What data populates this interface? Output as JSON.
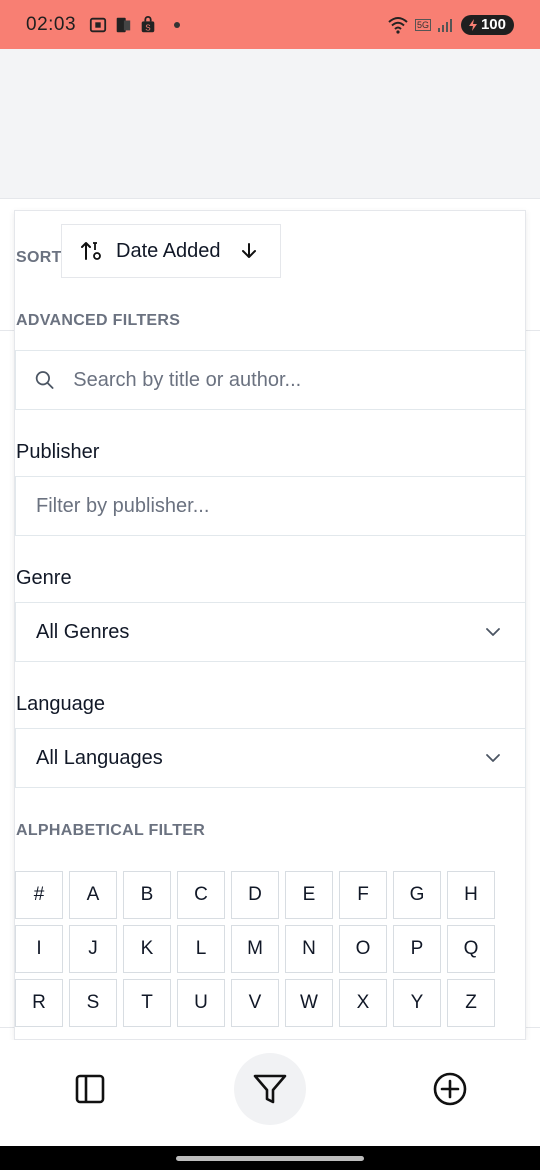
{
  "status": {
    "time": "02:03",
    "battery": "100",
    "net": "5G"
  },
  "sort": {
    "label": "SORT",
    "value": "Date Added"
  },
  "filters": {
    "advanced_label": "ADVANCED FILTERS",
    "search_placeholder": "Search by title or author...",
    "publisher_label": "Publisher",
    "publisher_placeholder": "Filter by publisher...",
    "genre_label": "Genre",
    "genre_value": "All Genres",
    "language_label": "Language",
    "language_value": "All Languages",
    "alpha_label": "ALPHABETICAL FILTER",
    "letters": [
      "#",
      "A",
      "B",
      "C",
      "D",
      "E",
      "F",
      "G",
      "H",
      "I",
      "J",
      "K",
      "L",
      "M",
      "N",
      "O",
      "P",
      "Q",
      "R",
      "S",
      "T",
      "U",
      "V",
      "W",
      "X",
      "Y",
      "Z"
    ]
  },
  "nav": {
    "items": [
      "sidebar-icon",
      "filter-icon",
      "add-circle-icon"
    ]
  },
  "colors": {
    "statusbar": "#f87f73",
    "accent_gray": "#6b7280"
  }
}
